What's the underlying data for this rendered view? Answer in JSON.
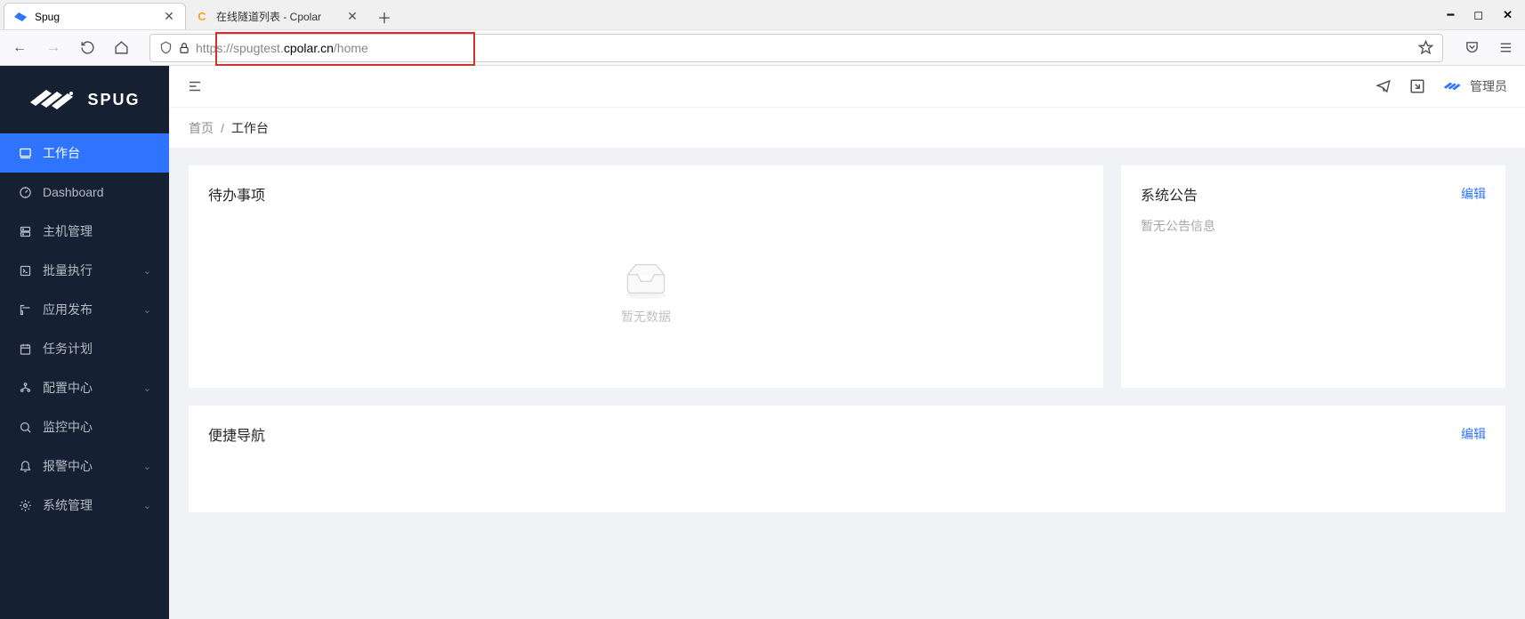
{
  "browser": {
    "tabs": [
      {
        "title": "Spug",
        "active": true
      },
      {
        "title": "在线隧道列表 - Cpolar",
        "active": false
      }
    ],
    "url": {
      "prefix": "https://spugtest.",
      "domain": "cpolar.cn",
      "path": "/home"
    }
  },
  "app": {
    "logo_text": "SPUG",
    "user_label": "管理员",
    "sidebar": [
      {
        "key": "workspace",
        "label": "工作台",
        "active": true,
        "expandable": false
      },
      {
        "key": "dashboard",
        "label": "Dashboard",
        "active": false,
        "expandable": false
      },
      {
        "key": "hosts",
        "label": "主机管理",
        "active": false,
        "expandable": false
      },
      {
        "key": "batch",
        "label": "批量执行",
        "active": false,
        "expandable": true
      },
      {
        "key": "deploy",
        "label": "应用发布",
        "active": false,
        "expandable": true
      },
      {
        "key": "tasks",
        "label": "任务计划",
        "active": false,
        "expandable": false
      },
      {
        "key": "config",
        "label": "配置中心",
        "active": false,
        "expandable": true
      },
      {
        "key": "monitor",
        "label": "监控中心",
        "active": false,
        "expandable": false
      },
      {
        "key": "alarm",
        "label": "报警中心",
        "active": false,
        "expandable": true
      },
      {
        "key": "system",
        "label": "系统管理",
        "active": false,
        "expandable": true
      }
    ],
    "breadcrumb": {
      "home": "首页",
      "current": "工作台"
    },
    "cards": {
      "todo": {
        "title": "待办事项",
        "empty": "暂无数据"
      },
      "notice": {
        "title": "系统公告",
        "link": "编辑",
        "empty": "暂无公告信息"
      },
      "nav": {
        "title": "便捷导航",
        "link": "编辑"
      }
    }
  }
}
